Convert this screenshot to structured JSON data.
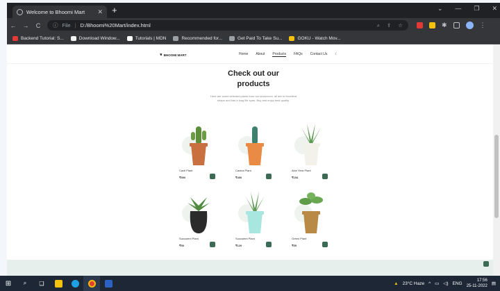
{
  "browser": {
    "tab_title": "Welcome to Bhoomi Mart",
    "new_tab": "+",
    "url_label": "File",
    "url": "D:/Bhoomi%20Mart/index.html",
    "window_controls": [
      "⌄",
      "—",
      "❐",
      "✕"
    ],
    "bookmarks": [
      {
        "label": "Backend Tutorial: S...",
        "color": "#e53935"
      },
      {
        "label": "Download Window...",
        "color": "#f2f2f2"
      },
      {
        "label": "Tutorials | MDN",
        "color": "#ffffff"
      },
      {
        "label": "Recommended for...",
        "color": "#9aa0a6"
      },
      {
        "label": "Get Paid To Take Su...",
        "color": "#9aa0a6"
      },
      {
        "label": "GOKU - Watch Mov...",
        "color": "#f4c20d"
      }
    ]
  },
  "site": {
    "logo": "BHOOMI MART",
    "nav": [
      "Home",
      "About",
      "Products",
      "FAQs",
      "Contact Us"
    ],
    "active_nav": "Products",
    "heading_line1": "Check out our",
    "heading_line2": "products",
    "subtext": "Here are some selected plants from our showroom, all are in excellent shape and has a long life span. Buy and enjoy best quality."
  },
  "products": [
    {
      "name": "Cacti Plant",
      "price": "₹500",
      "pot_color": "#c8703f"
    },
    {
      "name": "Cactus Plant",
      "price": "₹400",
      "pot_color": "#e98a45"
    },
    {
      "name": "Aloe Vera Plant",
      "price": "₹154",
      "pot_color": "#f2f2ea"
    },
    {
      "name": "Succulent Plant",
      "price": "₹50",
      "pot_color": "#2b2b2b"
    },
    {
      "name": "Succulent Plant",
      "price": "₹120",
      "pot_color": "#a8e6e0"
    },
    {
      "name": "Green Plant",
      "price": "₹55",
      "pot_color": "#b98a45"
    }
  ],
  "taskbar": {
    "weather": "23°C  Haze",
    "lang": "ENG",
    "time": "17:56",
    "date": "25-11-2022"
  },
  "colors": {
    "accent": "#3c6b55"
  }
}
